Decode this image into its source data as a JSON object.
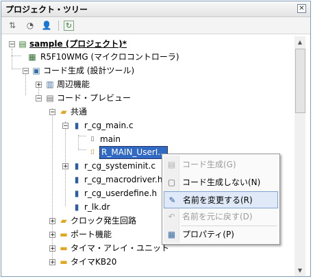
{
  "panel": {
    "title": "プロジェクト・ツリー",
    "close_icon": "close-x-icon"
  },
  "toolbar": {
    "icons": [
      "sort-icon",
      "properties-icon",
      "person-icon",
      "refresh-icon"
    ]
  },
  "tree": {
    "root": {
      "label": "sample (プロジェクト)*"
    },
    "device": {
      "label": "R5F10WMG (マイクロコントローラ)"
    },
    "codegen": {
      "label": "コード生成 (設計ツール)"
    },
    "peripheral": {
      "label": "周辺機能"
    },
    "preview": {
      "label": "コード・プレビュー"
    },
    "common": {
      "label": "共通"
    },
    "main_c": {
      "label": "r_cg_main.c"
    },
    "main_func": {
      "label": "main"
    },
    "user_init": {
      "label": "R_MAIN_UserI..."
    },
    "systeminit": {
      "label": "r_cg_systeminit.c"
    },
    "macrodriver": {
      "label": "r_cg_macrodriver.h"
    },
    "userdefine": {
      "label": "r_cg_userdefine.h"
    },
    "lkdr": {
      "label": "r_lk.dr"
    },
    "clock": {
      "label": "クロック発生回路"
    },
    "port": {
      "label": "ポート機能"
    },
    "timer_array": {
      "label": "タイマ・アレイ・ユニット"
    },
    "timer_kb": {
      "label": "タイマKB20"
    }
  },
  "context_menu": {
    "items": [
      {
        "label": "コード生成(G)",
        "enabled": false
      },
      {
        "label": "コード生成しない(N)",
        "enabled": true
      },
      {
        "label": "名前を変更する(R)",
        "enabled": true,
        "highlighted": true
      },
      {
        "label": "名前を元に戻す(D)",
        "enabled": false
      },
      {
        "label": "プロパティ(P)",
        "enabled": true
      }
    ]
  }
}
